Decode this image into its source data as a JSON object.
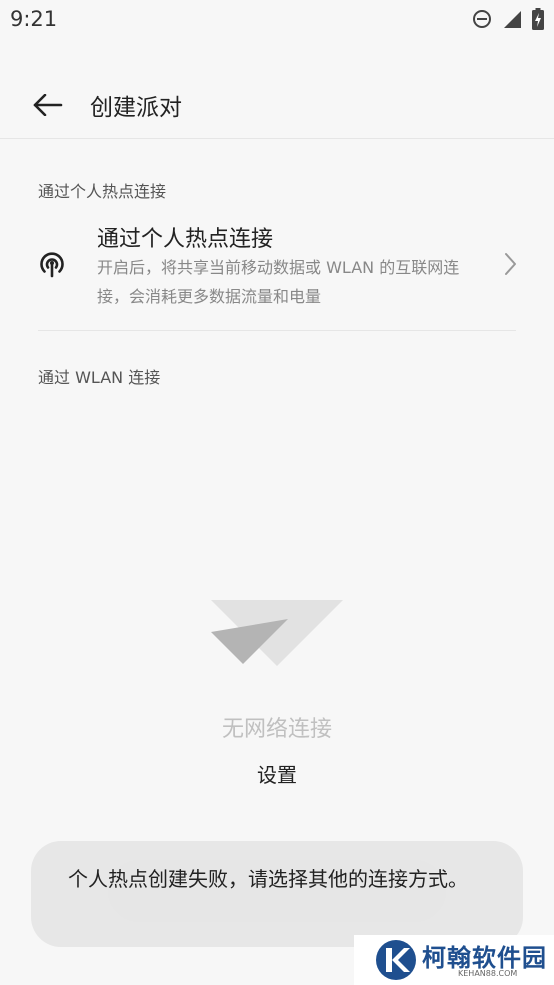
{
  "status_bar": {
    "time": "9:21"
  },
  "app_bar": {
    "title": "创建派对"
  },
  "hotspot_section": {
    "header": "通过个人热点连接",
    "item": {
      "title": "通过个人热点连接",
      "description": "开启后，将共享当前移动数据或 WLAN 的互联网连接，会消耗更多数据流量和电量"
    }
  },
  "wlan_section": {
    "header": "通过 WLAN 连接"
  },
  "empty_state": {
    "message": "无网络连接",
    "action": "设置"
  },
  "toast": {
    "message": "个人热点创建失败，请选择其他的连接方式。"
  },
  "watermark": {
    "name": "柯翰软件园",
    "url": "KEHAN88.COM"
  },
  "colors": {
    "accent": "#222222",
    "watermark": "#1f4f8f"
  },
  "icons": [
    "dnd-icon",
    "signal-icon",
    "battery-charging-icon",
    "back-arrow-icon",
    "hotspot-icon",
    "chevron-right-icon",
    "wifi-off-icon"
  ]
}
